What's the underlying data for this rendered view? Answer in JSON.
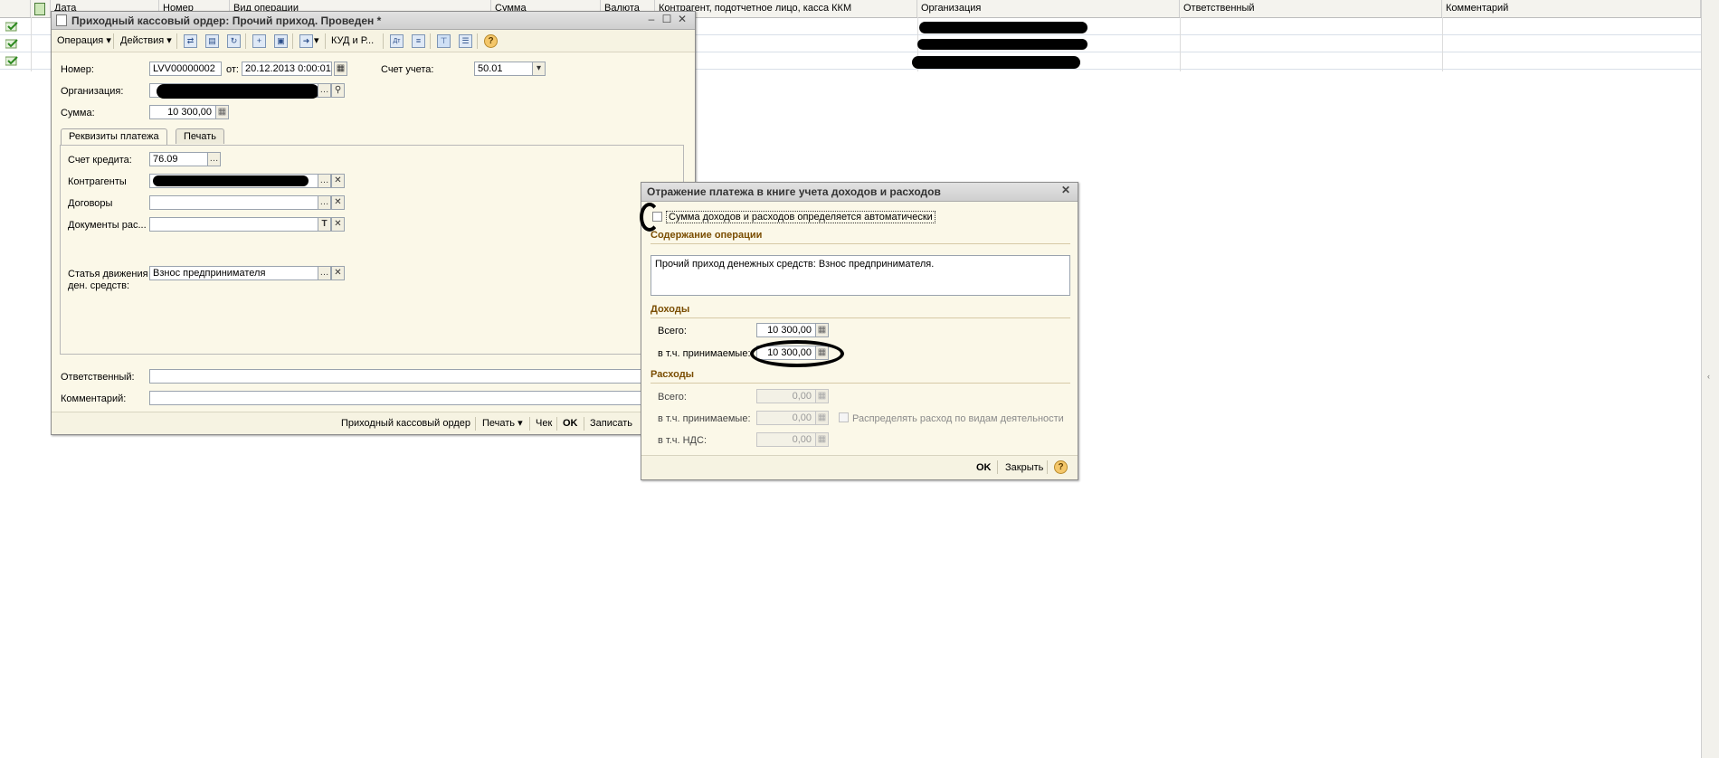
{
  "list": {
    "columns": [
      "",
      "",
      "Дата",
      "Номер",
      "Вид операции",
      "Сумма",
      "Валюта",
      "Контрагент, подотчетное лицо, касса ККМ",
      "Организация",
      "Ответственный",
      "Комментарий"
    ]
  },
  "order_window": {
    "title": "Приходный кассовый ордер: Прочий приход. Проведен *",
    "toolbar": {
      "operation": "Операция",
      "actions": "Действия",
      "kud": "КУД и Р..."
    },
    "number_label": "Номер:",
    "number_value": "LVV00000002",
    "from_label": "от:",
    "date_value": "20.12.2013  0:00:01",
    "account_label": "Счет учета:",
    "account_value": "50.01",
    "org_label": "Организация:",
    "sum_label": "Сумма:",
    "sum_value": "10 300,00",
    "tabs": [
      "Реквизиты платежа",
      "Печать"
    ],
    "credit_account_label": "Счет кредита:",
    "credit_account_value": "76.09",
    "contractors_label": "Контрагенты",
    "contracts_label": "Договоры",
    "docs_label": "Документы рас...",
    "cashflow_label_1": "Статья движения",
    "cashflow_label_2": "ден. средств:",
    "cashflow_value": "Взнос предпринимателя",
    "responsible_label": "Ответственный:",
    "comment_label": "Комментарий:",
    "footer": {
      "order": "Приходный кассовый ордер",
      "print": "Печать",
      "check": "Чек",
      "ok": "OK",
      "save": "Записать"
    }
  },
  "payment_dialog": {
    "title": "Отражение платежа в книге учета доходов и расходов",
    "auto_checkbox_label": "Сумма доходов и расходов определяется автоматически",
    "content_section": "Содержание операции",
    "content_text": "Прочий приход денежных средств: Взнос предпринимателя.",
    "income_section": "Доходы",
    "income_total_label": "Всего:",
    "income_total_value": "10 300,00",
    "income_accepted_label": "в т.ч. принимаемые:",
    "income_accepted_value": "10 300,00",
    "expense_section": "Расходы",
    "expense_total_label": "Всего:",
    "expense_total_value": "0,00",
    "expense_accepted_label": "в т.ч. принимаемые:",
    "expense_accepted_value": "0,00",
    "distribute_label": "Распределять расход по видам деятельности",
    "vat_label": "в т.ч. НДС:",
    "vat_value": "0,00",
    "footer": {
      "ok": "OK",
      "close": "Закрыть"
    }
  }
}
